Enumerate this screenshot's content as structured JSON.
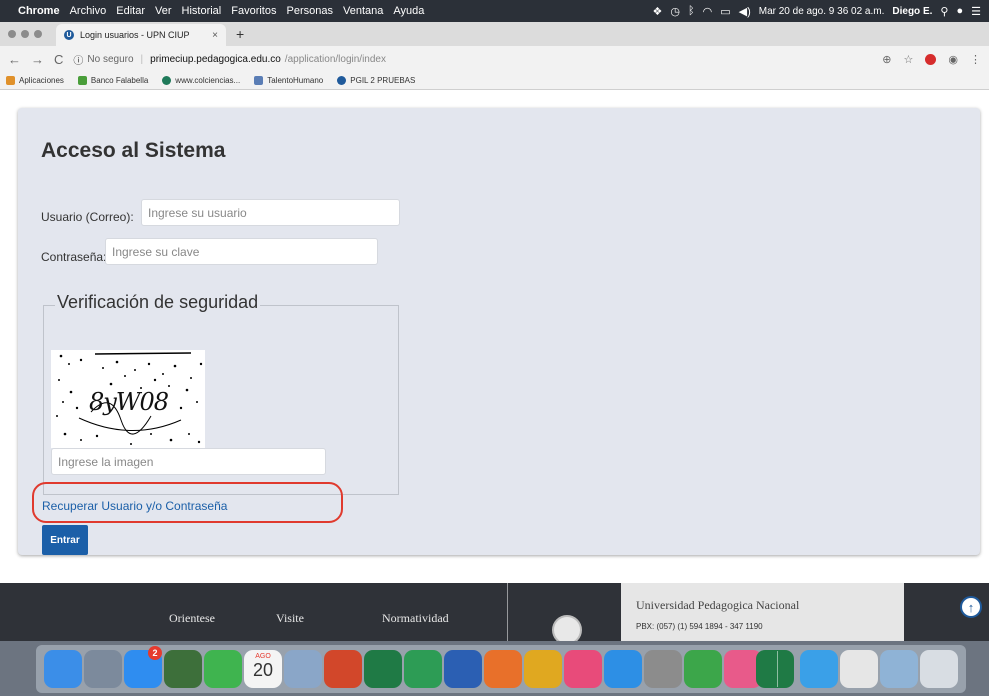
{
  "menubar": {
    "items": [
      "Chrome",
      "Archivo",
      "Editar",
      "Ver",
      "Historial",
      "Favoritos",
      "Personas",
      "Ventana",
      "Ayuda"
    ],
    "clock": "Mar 20 de ago. 9 36 02 a.m.",
    "user": "Diego E."
  },
  "tab": {
    "title": "Login usuarios - UPN CIUP",
    "close": "×",
    "favicon": "U",
    "newtab": "+"
  },
  "address": {
    "not_secure": "No seguro",
    "host": "primeciup.pedagogica.edu.co",
    "path": "/application/login/index"
  },
  "bookmarks": [
    {
      "label": "Aplicaciones",
      "color": "#e0912b"
    },
    {
      "label": "Banco Falabella",
      "color": "#4a9e3a"
    },
    {
      "label": "www.colciencias...",
      "color": "#1f7a5a"
    },
    {
      "label": "TalentoHumano",
      "color": "#5a7db5"
    },
    {
      "label": "PGIL 2 PRUEBAS",
      "color": "#1f5a9b"
    }
  ],
  "login": {
    "title": "Acceso al Sistema",
    "user_label": "Usuario (Correo):",
    "user_placeholder": "Ingrese su usuario",
    "pass_label": "Contraseña:",
    "pass_placeholder": "Ingrese su clave",
    "verification_legend": "Verificación de seguridad",
    "captcha_text": "8yW08",
    "captcha_placeholder": "Ingrese la imagen",
    "recover_link": "Recuperar Usuario y/o Contraseña",
    "submit": "Entrar"
  },
  "footer": {
    "links": [
      "Orientese",
      "Visite",
      "Normatividad"
    ],
    "university": "Universidad Pedagogica Nacional",
    "pbx": "PBX: (057) (1) 594 1894 - 347 1190",
    "up_icon": "↑"
  },
  "dock": {
    "appstore_badge": "2",
    "calendar_month": "AGO",
    "calendar_day": "20",
    "icons": [
      {
        "name": "finder-icon",
        "color": "#3b8ee8"
      },
      {
        "name": "launchpad-icon",
        "color": "#7c8a9c"
      },
      {
        "name": "app-store-icon",
        "color": "#2f8df0"
      },
      {
        "name": "contacts-icon",
        "color": "#3d6f3a"
      },
      {
        "name": "facetime-icon",
        "color": "#3fb44f"
      },
      {
        "name": "calendar-icon",
        "color": "#f4f4f4"
      },
      {
        "name": "preview-icon",
        "color": "#8aa6c8"
      },
      {
        "name": "powerpoint-icon",
        "color": "#d2472a"
      },
      {
        "name": "excel-icon",
        "color": "#1f7a45"
      },
      {
        "name": "excel-x-icon",
        "color": "#2d9c55"
      },
      {
        "name": "word-icon",
        "color": "#2b5fb3"
      },
      {
        "name": "firefox-icon",
        "color": "#e8702a"
      },
      {
        "name": "chrome-icon",
        "color": "#e0a820"
      },
      {
        "name": "itunes-icon",
        "color": "#e84b7a"
      },
      {
        "name": "safari-icon",
        "color": "#2d8fe5"
      },
      {
        "name": "system-preferences-icon",
        "color": "#8c8c8c"
      },
      {
        "name": "numbers-icon",
        "color": "#3ca64a"
      },
      {
        "name": "photos-icon",
        "color": "#e85a8a"
      },
      {
        "name": "excel-doc-icon",
        "color": "#1f7a45"
      },
      {
        "name": "folder-icon",
        "color": "#3aa0e8"
      },
      {
        "name": "document-icon",
        "color": "#e6e6e6"
      },
      {
        "name": "downloads-icon",
        "color": "#8fb3d6"
      },
      {
        "name": "trash-icon",
        "color": "#d8dde3"
      }
    ]
  }
}
